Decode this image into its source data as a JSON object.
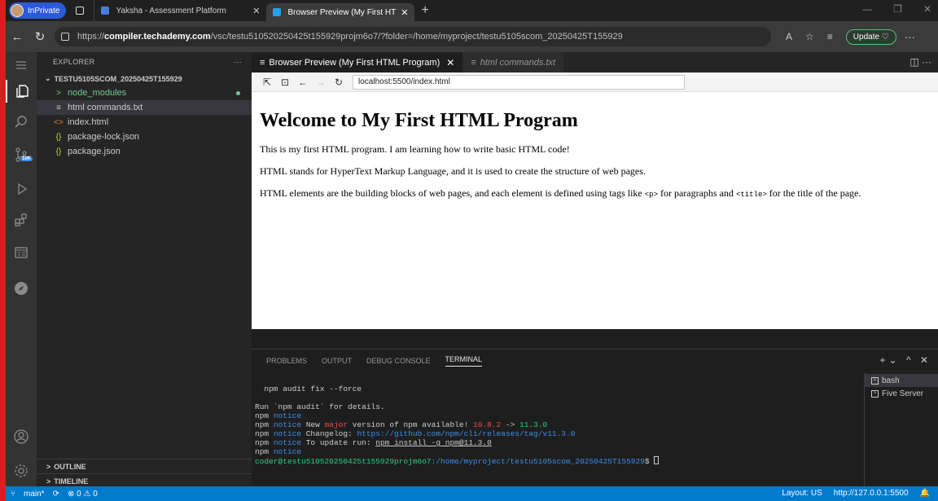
{
  "browser": {
    "profile_label": "InPrivate",
    "tabs": [
      {
        "title": "Yaksha - Assessment Platform"
      },
      {
        "title": "Browser Preview (My First HTML P"
      }
    ],
    "address": {
      "prefix": "https://",
      "host": "compiler.techademy.com",
      "path": "/vsc/testu510520250425t155929projm6o7/?folder=/home/myproject/testu5105scom_20250425T155929"
    },
    "update_label": "Update"
  },
  "explorer": {
    "title": "EXPLORER",
    "root": "TESTU5105SCOM_20250425T155929",
    "items": [
      {
        "icon": ">",
        "label": "node_modules"
      },
      {
        "icon": "≡",
        "label": "html commands.txt"
      },
      {
        "icon": "<>",
        "label": "index.html"
      },
      {
        "icon": "{}",
        "label": "package-lock.json"
      },
      {
        "icon": "{}",
        "label": "package.json"
      }
    ],
    "outline": "OUTLINE",
    "timeline": "TIMELINE",
    "scm_badge": "10K"
  },
  "editor": {
    "tabs": [
      {
        "label": "Browser Preview (My First HTML Program)"
      },
      {
        "label": "html commands.txt"
      }
    ]
  },
  "preview": {
    "url": "localhost:5500/index.html",
    "heading": "Welcome to My First HTML Program",
    "p1": "This is my first HTML program. I am learning how to write basic HTML code!",
    "p2": "HTML stands for HyperText Markup Language, and it is used to create the structure of web pages.",
    "p3_a": "HTML elements are the building blocks of web pages, and each element is defined using tags like",
    "p3_code1": "<p>",
    "p3_b": "for paragraphs and",
    "p3_code2": "<title>",
    "p3_c": "for the title of the page."
  },
  "panel": {
    "tabs": [
      "PROBLEMS",
      "OUTPUT",
      "DEBUG CONSOLE",
      "TERMINAL"
    ],
    "terminal": {
      "l1": "  npm audit fix --force",
      "l2": "Run `npm audit` for details.",
      "npm": "npm",
      "notice": "notice",
      "l4a": "New",
      "l4b": "major",
      "l4c": "version of npm available!",
      "l4d": "10.8.2",
      "l4e": "->",
      "l4f": "11.3.0",
      "l5a": "Changelog:",
      "l5b": "https://github.com/npm/cli/releases/tag/v11.3.0",
      "l6a": "To update run:",
      "l6b": "npm install -g npm@11.3.0",
      "prompt_user": "coder@testu510520250425t155929projm6o7",
      "prompt_path": ":/home/myproject/testu5105scom_20250425T155929",
      "prompt_end": "$"
    },
    "terminals": [
      "bash",
      "Five Server"
    ]
  },
  "status": {
    "branch": "main*",
    "problems": "⊗ 0 ⚠ 0",
    "layout": "Layout: US",
    "server": "http://127.0.0.1:5500"
  }
}
